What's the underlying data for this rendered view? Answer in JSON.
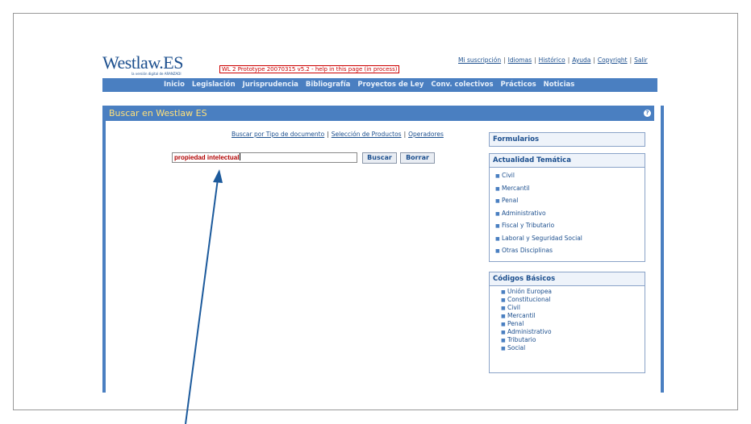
{
  "brand": {
    "logo": "Westlaw.ES",
    "tagline": "la versión digital de ARANZADI"
  },
  "prototype_notice": "WL 2 Prototype 20070315 v5.2 - help in this page (in process)",
  "top_links": [
    "Mi suscripción",
    "Idiomas",
    "Histórico",
    "Ayuda",
    "Copyright",
    "Salir"
  ],
  "nav": [
    "Inicio",
    "Legislación",
    "Jurisprudencia",
    "Bibliografía",
    "Proyectos de Ley",
    "Conv. colectivos",
    "Prácticos",
    "Noticias"
  ],
  "panel": {
    "title": "Buscar en Westlaw ES",
    "help_icon": "help-icon"
  },
  "search_links": [
    "Buscar por Tipo de documento",
    "Selección de Productos",
    "Operadores"
  ],
  "search": {
    "value": "propiedad intelectual",
    "buscar": "Buscar",
    "borrar": "Borrar"
  },
  "formularios": "Formularios",
  "actualidad": {
    "title": "Actualidad Temática",
    "items": [
      "Civil",
      "Mercantil",
      "Penal",
      "Administrativo",
      "Fiscal y Tributario",
      "Laboral y Seguridad Social",
      "Otras Disciplinas"
    ]
  },
  "codigos": {
    "title": "Códigos Básicos",
    "items": [
      "Unión Europea",
      "Constitucional",
      "Civil",
      "Mercantil",
      "Penal",
      "Administrativo",
      "Tributario",
      "Social"
    ]
  },
  "colors": {
    "nav_blue": "#4a7fc1",
    "title_yellow": "#ffe07a",
    "input_text": "#b00000",
    "arrow": "#1c5a9c"
  }
}
